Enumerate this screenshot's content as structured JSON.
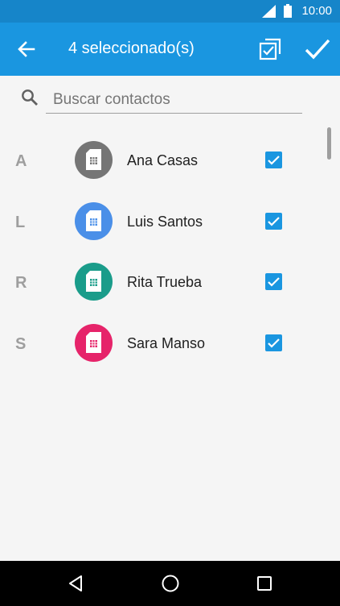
{
  "status_bar": {
    "time": "10:00"
  },
  "header": {
    "title": "4 seleccionado(s)"
  },
  "search": {
    "placeholder": "Buscar contactos"
  },
  "contacts": [
    {
      "letter": "A",
      "name": "Ana Casas",
      "avatar_color": "#757575",
      "checked": true
    },
    {
      "letter": "L",
      "name": "Luis Santos",
      "avatar_color": "#4a8fe8",
      "checked": true
    },
    {
      "letter": "R",
      "name": "Rita Trueba",
      "avatar_color": "#1a9c8a",
      "checked": true
    },
    {
      "letter": "S",
      "name": "Sara Manso",
      "avatar_color": "#e6246a",
      "checked": true
    }
  ],
  "colors": {
    "status_bar": "#1685c9",
    "app_bar": "#1a96e0",
    "accent": "#1a96e0"
  },
  "icons": {
    "back": "arrow-left-icon",
    "select_all": "select-all-icon",
    "confirm": "checkmark-icon",
    "search": "search-icon",
    "avatar": "sim-card-icon",
    "checkbox": "checkbox-checked-icon"
  }
}
